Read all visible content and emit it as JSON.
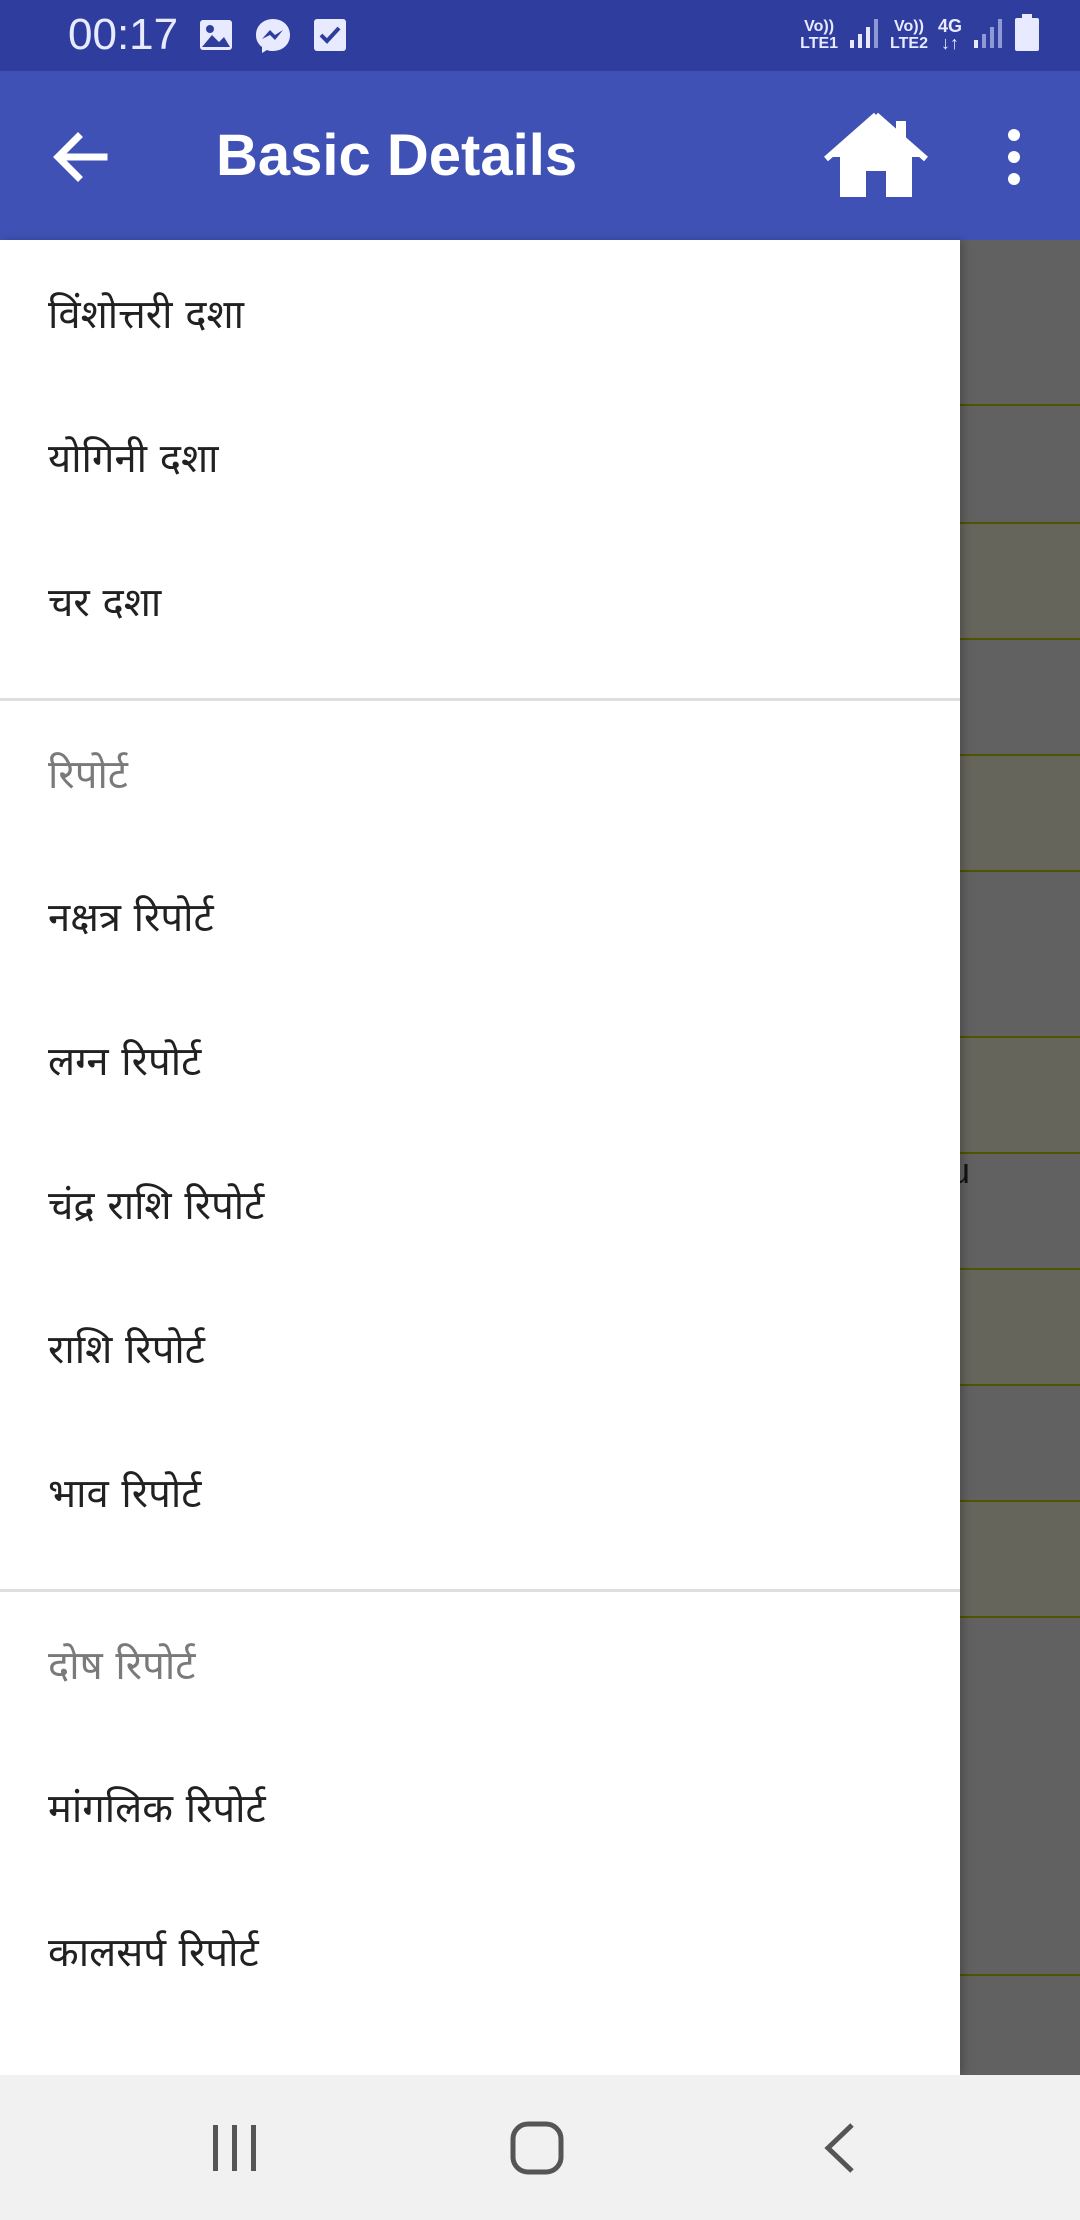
{
  "status_bar": {
    "time": "00:17",
    "notification_icons": [
      "gallery-icon",
      "messenger-icon",
      "checkbox-icon"
    ],
    "sim1_label_top": "Vo))",
    "sim1_label_bottom": "LTE1",
    "sim2_label_top": "Vo))",
    "sim2_label_bottom": "LTE2",
    "network_type": "4G"
  },
  "app_bar": {
    "title": "Basic Details",
    "color": "#3f51b5",
    "status_color": "#2f3e9e",
    "icons": [
      "back-arrow-icon",
      "home-icon",
      "more-vert-icon"
    ]
  },
  "background": {
    "partial_text": "nu"
  },
  "drawer": {
    "items_top": [
      "विंशोत्तरी दशा",
      "योगिनी दशा",
      "चर दशा"
    ],
    "section_report": {
      "header": "रिपोर्ट",
      "items": [
        "नक्षत्र रिपोर्ट",
        "लग्न रिपोर्ट",
        "चंद्र राशि रिपोर्ट",
        "राशि रिपोर्ट",
        "भाव रिपोर्ट"
      ]
    },
    "section_dosh": {
      "header": "दोष रिपोर्ट",
      "items": [
        "मांगलिक रिपोर्ट",
        "कालसर्प रिपोर्ट"
      ]
    }
  },
  "nav_bar": {
    "icons": [
      "recents-icon",
      "home-circle-icon",
      "back-chevron-icon"
    ]
  }
}
